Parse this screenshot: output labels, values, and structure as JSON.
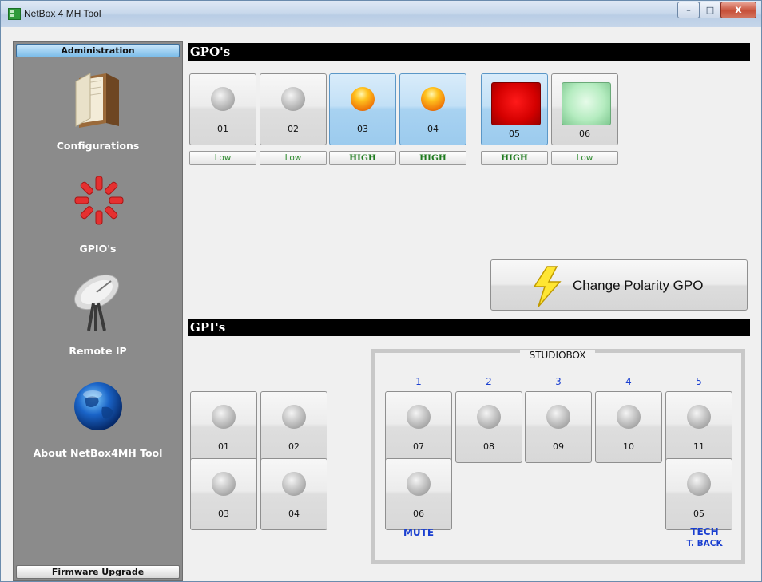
{
  "window": {
    "title": "NetBox 4 MH Tool",
    "minimize": "–",
    "maximize": "□",
    "close": "x"
  },
  "sidebar": {
    "header": "Administration",
    "footer": "Firmware Upgrade",
    "items": [
      {
        "label": "Configurations",
        "icon": "book-icon"
      },
      {
        "label": "GPIO's",
        "icon": "gpio-spinner-icon"
      },
      {
        "label": "Remote IP",
        "icon": "satellite-dish-icon"
      },
      {
        "label": "About NetBox4MH Tool",
        "icon": "globe-icon"
      }
    ]
  },
  "gpo": {
    "title": "GPO's",
    "tiles": [
      {
        "num": "01",
        "state": "Low",
        "led": "off"
      },
      {
        "num": "02",
        "state": "Low",
        "led": "off"
      },
      {
        "num": "03",
        "state": "HIGH",
        "led": "on"
      },
      {
        "num": "04",
        "state": "HIGH",
        "led": "on"
      },
      {
        "num": "05",
        "state": "HIGH",
        "led": "red-square"
      },
      {
        "num": "06",
        "state": "Low",
        "led": "green-square"
      }
    ],
    "polarity_button": "Change Polarity GPO"
  },
  "gpi": {
    "title": "GPI's",
    "local": [
      "01",
      "02",
      "03",
      "04"
    ],
    "studiobox": {
      "title": "STUDIOBOX",
      "column_numbers": [
        "1",
        "2",
        "3",
        "4",
        "5"
      ],
      "row1": [
        "07",
        "08",
        "09",
        "10",
        "11"
      ],
      "mute_tile": "06",
      "tech_tile": "05",
      "mute_label": "MUTE",
      "tech_label": "TECH",
      "tech_sub": "T. BACK"
    }
  },
  "colors": {
    "accent_blue": "#1a3fd0",
    "active_tile": "#a8d2f1",
    "state_green": "#2e8b2e"
  }
}
